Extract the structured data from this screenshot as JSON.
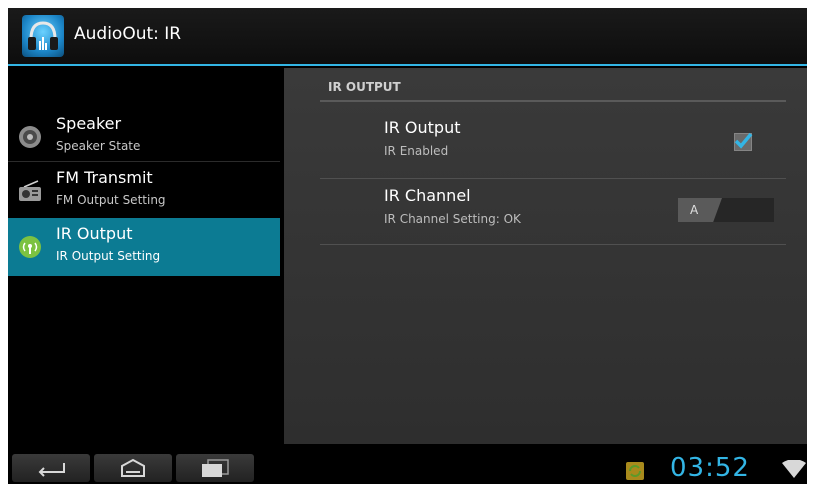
{
  "action_bar": {
    "title": "AudioOut: IR"
  },
  "nav": {
    "items": [
      {
        "title": "Speaker",
        "subtitle": "Speaker State",
        "icon": "speaker-icon"
      },
      {
        "title": "FM Transmit",
        "subtitle": "FM Output Setting",
        "icon": "radio-icon"
      },
      {
        "title": "IR Output",
        "subtitle": "IR Output Setting",
        "icon": "ir-antenna-icon",
        "selected": true
      }
    ]
  },
  "detail": {
    "section_header": "IR OUTPUT",
    "ir_output": {
      "title": "IR Output",
      "summary": "IR Enabled",
      "checked": true
    },
    "ir_channel": {
      "title": "IR Channel",
      "summary": "IR Channel Setting: OK",
      "value": "A"
    }
  },
  "status_bar": {
    "time": "03:52"
  },
  "colors": {
    "accent": "#33b5e5",
    "selected_nav": "#0c7b93"
  }
}
